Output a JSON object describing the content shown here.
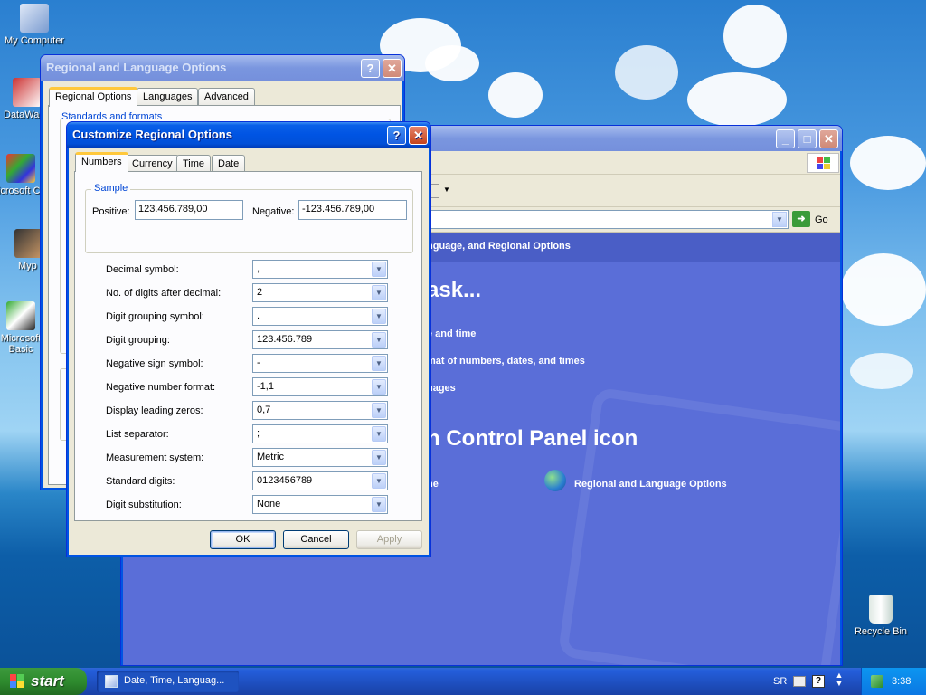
{
  "desktop": {
    "icons": [
      {
        "label": "My Computer"
      },
      {
        "label": "DataWa"
      },
      {
        "label": "Microsoft C++"
      },
      {
        "label": "Myp"
      },
      {
        "label": "Microsoft Basic"
      },
      {
        "label": "Recycle Bin"
      }
    ]
  },
  "regional_window": {
    "title": "Regional and Language Options",
    "tabs": [
      "Regional Options",
      "Languages",
      "Advanced"
    ],
    "group_label": "Standards and formats",
    "help_glyph": "?",
    "close_glyph": "✕"
  },
  "control_panel": {
    "go_label": "Go",
    "address_text": "nguage, and Regional Options",
    "heading_task": "ask...",
    "tasks": [
      "e and time",
      "mat of numbers, dates, and times",
      "uages"
    ],
    "heading_icon": "n Control Panel icon",
    "icon_items": [
      "ne",
      "Regional and Language Options"
    ]
  },
  "dialog": {
    "title": "Customize Regional Options",
    "tabs": [
      "Numbers",
      "Currency",
      "Time",
      "Date"
    ],
    "sample": {
      "group_label": "Sample",
      "positive_label": "Positive:",
      "positive_value": "123.456.789,00",
      "negative_label": "Negative:",
      "negative_value": "-123.456.789,00"
    },
    "settings": [
      {
        "label": "Decimal symbol:",
        "value": ","
      },
      {
        "label": "No. of digits after decimal:",
        "value": "2"
      },
      {
        "label": "Digit grouping symbol:",
        "value": "."
      },
      {
        "label": "Digit grouping:",
        "value": "123.456.789"
      },
      {
        "label": "Negative sign symbol:",
        "value": "-"
      },
      {
        "label": "Negative number format:",
        "value": "-1,1"
      },
      {
        "label": "Display leading zeros:",
        "value": "0,7"
      },
      {
        "label": "List separator:",
        "value": ";"
      },
      {
        "label": "Measurement system:",
        "value": "Metric"
      },
      {
        "label": "Standard digits:",
        "value": "0123456789"
      },
      {
        "label": "Digit substitution:",
        "value": "None"
      }
    ],
    "buttons": {
      "ok": "OK",
      "cancel": "Cancel",
      "apply": "Apply"
    }
  },
  "taskbar": {
    "start_label": "start",
    "task_label": "Date, Time, Languag...",
    "language": "SR",
    "clock": "3:38"
  },
  "colors": {
    "xp_blue": "#0054e3",
    "cp_panel": "#5a6ed8",
    "start_green": "#2e8b2e"
  }
}
